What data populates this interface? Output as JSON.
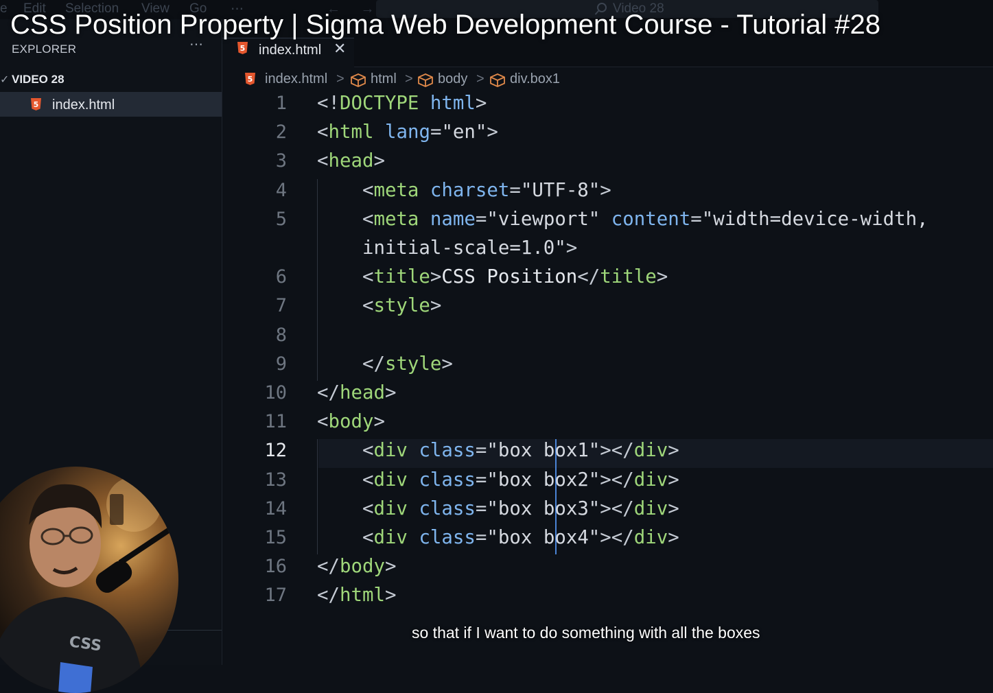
{
  "menu": {
    "items": [
      "e",
      "Edit",
      "Selection",
      "View",
      "Go",
      "⋯"
    ],
    "search_text": "Video 28"
  },
  "video_title": "CSS Position Property | Sigma Web Development Course - Tutorial #28",
  "sidebar": {
    "explorer_label": "EXPLORER",
    "more": "⋯",
    "folder": "VIDEO 28",
    "file": "index.html"
  },
  "tab": {
    "label": "index.html",
    "close": "✕"
  },
  "breadcrumb": {
    "items": [
      "index.html",
      "html",
      "body",
      "div.box1"
    ],
    "separator": ">"
  },
  "editor": {
    "active_line": 12,
    "lines": [
      {
        "no": "1",
        "segments": [
          [
            "br",
            "<!"
          ],
          [
            "tag",
            "DOCTYPE"
          ],
          [
            "br",
            " "
          ],
          [
            "attr",
            "html"
          ],
          [
            "br",
            ">"
          ]
        ]
      },
      {
        "no": "2",
        "segments": [
          [
            "br",
            "<"
          ],
          [
            "tag",
            "html"
          ],
          [
            "br",
            " "
          ],
          [
            "attr",
            "lang"
          ],
          [
            "br",
            "="
          ],
          [
            "str",
            "\"en\""
          ],
          [
            "br",
            ">"
          ]
        ]
      },
      {
        "no": "3",
        "segments": [
          [
            "br",
            "<"
          ],
          [
            "tag",
            "head"
          ],
          [
            "br",
            ">"
          ]
        ]
      },
      {
        "no": "4",
        "segments": [
          [
            "br",
            "    <"
          ],
          [
            "tag",
            "meta"
          ],
          [
            "br",
            " "
          ],
          [
            "attr",
            "charset"
          ],
          [
            "br",
            "="
          ],
          [
            "str",
            "\"UTF-8\""
          ],
          [
            "br",
            ">"
          ]
        ]
      },
      {
        "no": "5",
        "segments": [
          [
            "br",
            "    <"
          ],
          [
            "tag",
            "meta"
          ],
          [
            "br",
            " "
          ],
          [
            "attr",
            "name"
          ],
          [
            "br",
            "="
          ],
          [
            "str",
            "\"viewport\""
          ],
          [
            "br",
            " "
          ],
          [
            "attr",
            "content"
          ],
          [
            "br",
            "="
          ],
          [
            "str",
            "\"width=device-width,"
          ]
        ]
      },
      {
        "no": "",
        "segments": [
          [
            "str",
            "    initial-scale=1.0\""
          ],
          [
            "br",
            ">"
          ]
        ]
      },
      {
        "no": "6",
        "segments": [
          [
            "br",
            "    <"
          ],
          [
            "tag",
            "title"
          ],
          [
            "br",
            ">"
          ],
          [
            "txt",
            "CSS Position"
          ],
          [
            "br",
            "</"
          ],
          [
            "tag",
            "title"
          ],
          [
            "br",
            ">"
          ]
        ]
      },
      {
        "no": "7",
        "segments": [
          [
            "br",
            "    <"
          ],
          [
            "tag",
            "style"
          ],
          [
            "br",
            ">"
          ]
        ]
      },
      {
        "no": "8",
        "segments": []
      },
      {
        "no": "9",
        "segments": [
          [
            "br",
            "    </"
          ],
          [
            "tag",
            "style"
          ],
          [
            "br",
            ">"
          ]
        ]
      },
      {
        "no": "10",
        "segments": [
          [
            "br",
            "</"
          ],
          [
            "tag",
            "head"
          ],
          [
            "br",
            ">"
          ]
        ]
      },
      {
        "no": "11",
        "segments": [
          [
            "br",
            "<"
          ],
          [
            "tag",
            "body"
          ],
          [
            "br",
            ">"
          ]
        ]
      },
      {
        "no": "12",
        "segments": [
          [
            "br",
            "    <"
          ],
          [
            "tag",
            "div"
          ],
          [
            "br",
            " "
          ],
          [
            "attr",
            "class"
          ],
          [
            "br",
            "="
          ],
          [
            "str",
            "\"box box1\""
          ],
          [
            "br",
            "></"
          ],
          [
            "tag",
            "div"
          ],
          [
            "br",
            ">"
          ]
        ]
      },
      {
        "no": "13",
        "segments": [
          [
            "br",
            "    <"
          ],
          [
            "tag",
            "div"
          ],
          [
            "br",
            " "
          ],
          [
            "attr",
            "class"
          ],
          [
            "br",
            "="
          ],
          [
            "str",
            "\"box box2\""
          ],
          [
            "br",
            "></"
          ],
          [
            "tag",
            "div"
          ],
          [
            "br",
            ">"
          ]
        ]
      },
      {
        "no": "14",
        "segments": [
          [
            "br",
            "    <"
          ],
          [
            "tag",
            "div"
          ],
          [
            "br",
            " "
          ],
          [
            "attr",
            "class"
          ],
          [
            "br",
            "="
          ],
          [
            "str",
            "\"box box3\""
          ],
          [
            "br",
            "></"
          ],
          [
            "tag",
            "div"
          ],
          [
            "br",
            ">"
          ]
        ]
      },
      {
        "no": "15",
        "segments": [
          [
            "br",
            "    <"
          ],
          [
            "tag",
            "div"
          ],
          [
            "br",
            " "
          ],
          [
            "attr",
            "class"
          ],
          [
            "br",
            "="
          ],
          [
            "str",
            "\"box box4\""
          ],
          [
            "br",
            "></"
          ],
          [
            "tag",
            "div"
          ],
          [
            "br",
            ">"
          ]
        ]
      },
      {
        "no": "16",
        "segments": [
          [
            "br",
            "</"
          ],
          [
            "tag",
            "body"
          ],
          [
            "br",
            ">"
          ]
        ]
      },
      {
        "no": "17",
        "segments": [
          [
            "br",
            "</"
          ],
          [
            "tag",
            "html"
          ],
          [
            "br",
            ">"
          ]
        ]
      }
    ]
  },
  "subtitle": "so that if I want to do something with all the boxes",
  "colors": {
    "tag": "#9fd77a",
    "attribute": "#7fb5ee",
    "html5_badge": "#e4572e",
    "cube_icon": "#e0894a"
  },
  "webcam_overlay": {
    "visible": true
  }
}
